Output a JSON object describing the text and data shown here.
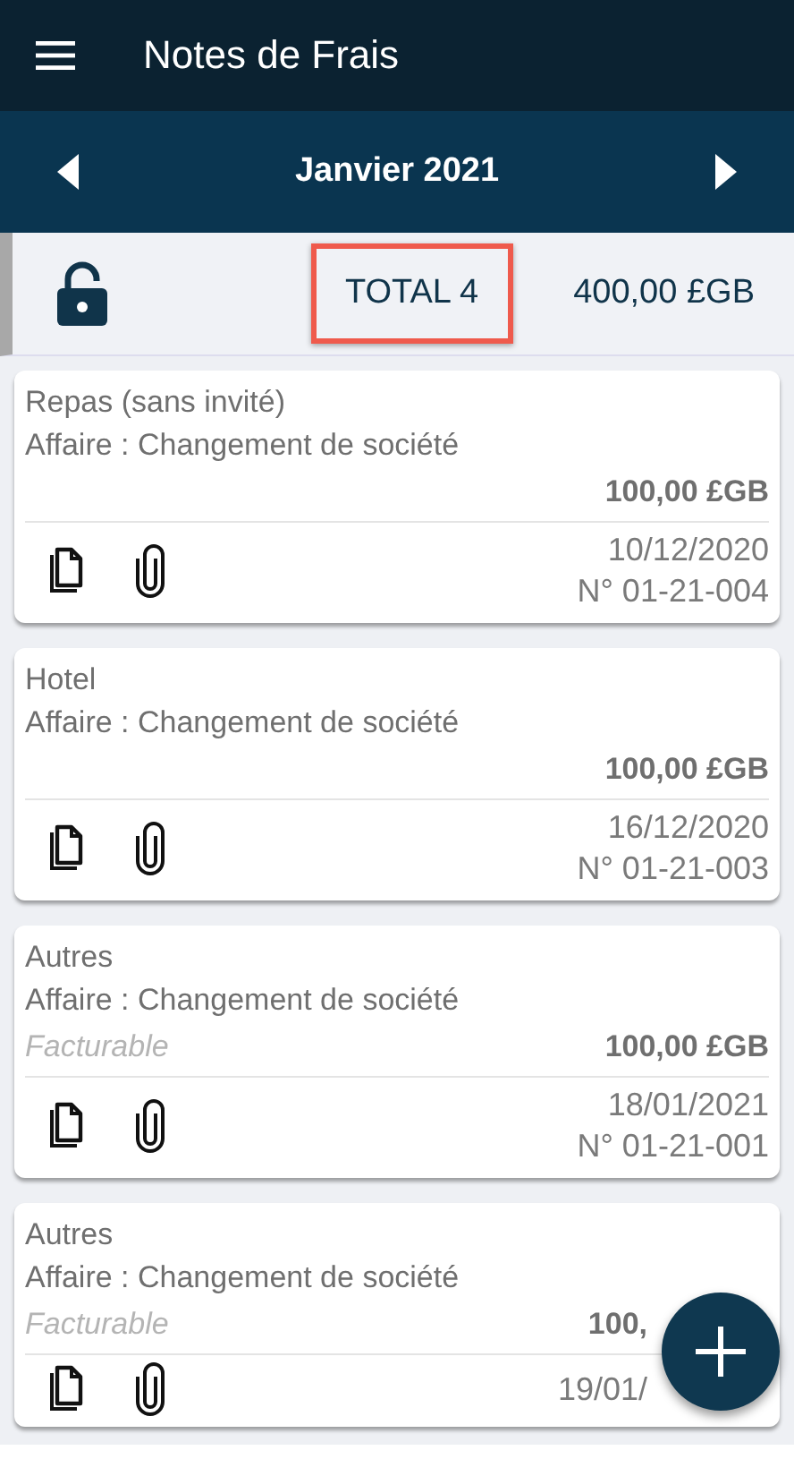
{
  "app_bar": {
    "title": "Notes de Frais"
  },
  "month_bar": {
    "label": "Janvier 2021"
  },
  "summary": {
    "locked": false,
    "total_label": "TOTAL 4",
    "amount": "400,00 £GB",
    "highlighted": true
  },
  "expenses": [
    {
      "category": "Repas (sans invité)",
      "project": "Affaire : Changement de société",
      "amount": "100,00 £GB",
      "date": "10/12/2020",
      "number": "N° 01-21-004"
    },
    {
      "category": "Hotel",
      "project": "Affaire : Changement de société",
      "amount": "100,00 £GB",
      "date": "16/12/2020",
      "number": "N° 01-21-003"
    },
    {
      "category": "Autres",
      "project": "Affaire : Changement de société",
      "note": "Facturable",
      "amount": "100,00 £GB",
      "date": "18/01/2021",
      "number": "N° 01-21-001"
    },
    {
      "category": "Autres",
      "project": "Affaire : Changement de société",
      "note": "Facturable",
      "amount": "100,",
      "date": "19/01/"
    }
  ]
}
